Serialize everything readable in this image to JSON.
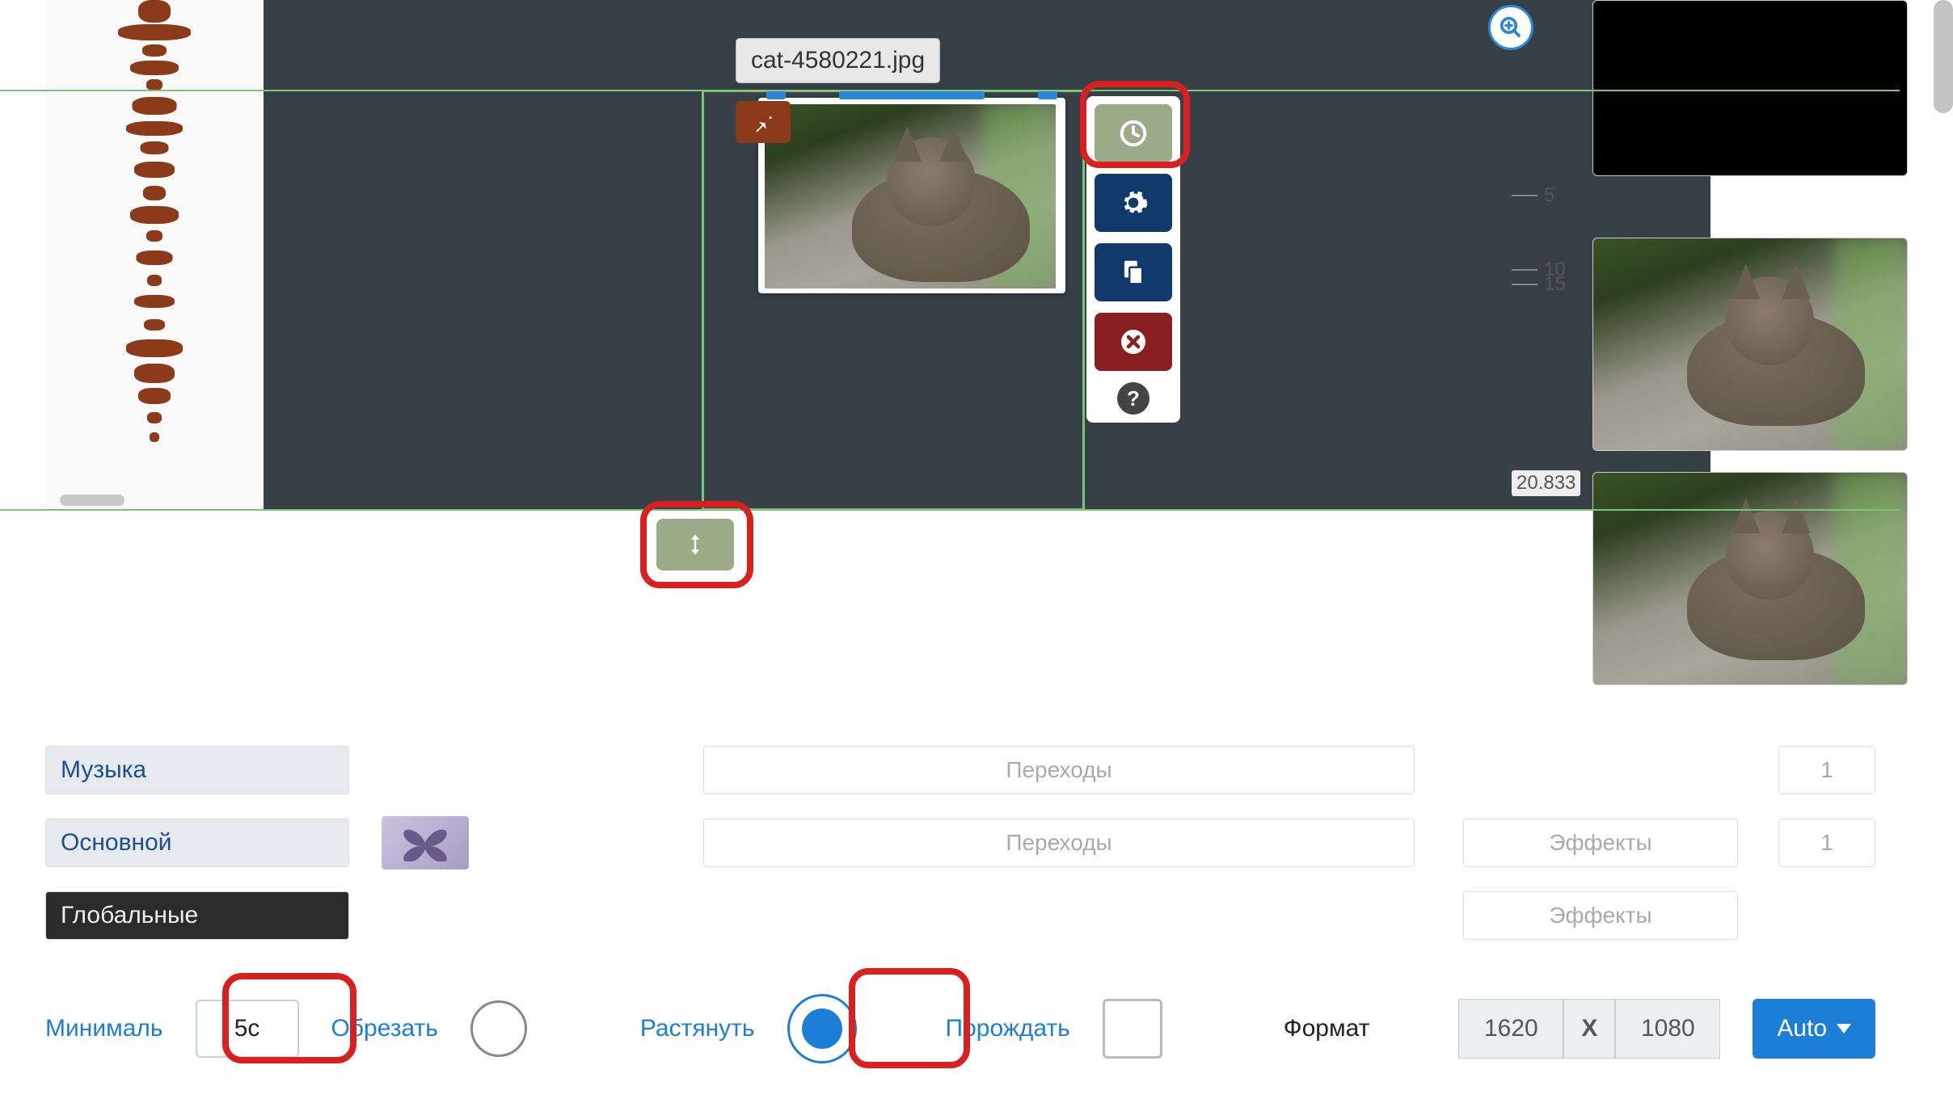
{
  "clip": {
    "filename": "cat-4580221.jpg"
  },
  "timeline": {
    "markers": [
      "5",
      "10",
      "15",
      "20.833"
    ]
  },
  "sidebar_layers": {
    "music": "Музыка",
    "main": "Основной",
    "global": "Глобальные"
  },
  "transitions": {
    "label": "Переходы",
    "count1": "1",
    "count2": "1"
  },
  "effects": {
    "label": "Эффекты"
  },
  "bottom": {
    "minimal_label": "Минималь",
    "minimal_value": "5с",
    "crop_label": "Обрезать",
    "stretch_label": "Растянуть",
    "spawn_label": "Порождать",
    "format_label": "Формат",
    "width": "1620",
    "height": "1080",
    "x": "X",
    "auto": "Auto"
  },
  "icons": {
    "pin": "pin",
    "clock": "clock",
    "gear": "gear",
    "copy": "copy",
    "delete": "delete",
    "help": "?",
    "zoom_in": "zoom-in",
    "arrows_v": "arrows-v"
  }
}
